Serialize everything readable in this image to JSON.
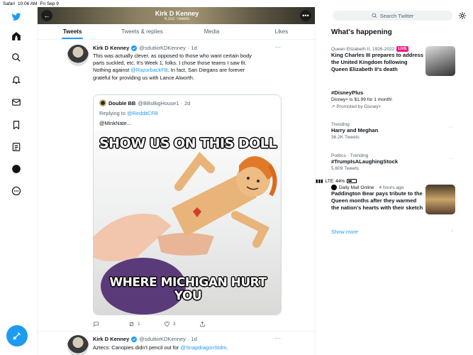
{
  "status_bar": {
    "back_app": "Safari",
    "time": "10:06 AM",
    "date": "Fri Sep 9",
    "network": "LTE",
    "battery": "44%"
  },
  "profile": {
    "name": "Kirk D Kenney",
    "tweet_count": "9,152 Tweets"
  },
  "tabs": [
    {
      "label": "Tweets",
      "active": true
    },
    {
      "label": "Tweets & replies",
      "active": false
    },
    {
      "label": "Media",
      "active": false
    },
    {
      "label": "Likes",
      "active": false
    }
  ],
  "tweet1": {
    "name": "Kirk D Kenney",
    "handle": "@sdutkirKDKenney",
    "time": "· 1d",
    "lines": [
      "This was actually clever, as opposed to those who want certain body",
      "parts suckled, etc. It's Week 1, folks. I chose those teams I saw fit.",
      "Nothing against ",
      "@RazorbackFB",
      ". In fact, San Diegans are forever",
      "grateful for providing us with Lance Alworth."
    ],
    "quote": {
      "name": "Double BB",
      "handle": "@BBsBigHouse1",
      "time": "· 2d",
      "replying_prefix": "Replying to ",
      "replying_to": "@RedditCFB",
      "text": "@MinkNate...",
      "meme_top": "SHOW US ON THIS DOLL",
      "meme_bottom_1": "WHERE MICHIGAN HURT",
      "meme_bottom_2": "YOU"
    },
    "retweets": "1",
    "likes": "3"
  },
  "tweet2": {
    "name": "Kirk D Kenney",
    "handle": "@sdutkirKDKenney",
    "time": "· 1d",
    "text_prefix": "Aztecs: Canopies didn't pencil out for ",
    "text_link": "@SnapdragonStdm",
    "text_suffix": "."
  },
  "search": {
    "placeholder": "Search Twitter"
  },
  "whats_happening": {
    "title": "What's happening",
    "trends": [
      {
        "meta": "Queen Elizabeth II, 1926-2022",
        "badge": "LIVE",
        "title": "King Charles III prepares to address the United Kingdom following Queen Elizabeth II's death"
      },
      {
        "title": "#DisneyPlus",
        "sub": "Disney+ is $1.99 for 1 month!",
        "promo": "Promoted by Disney+"
      },
      {
        "meta": "Trending",
        "title": "Harry and Meghan",
        "sub": "36.2K Tweets"
      },
      {
        "meta": "Politics · Trending",
        "title": "#TrumpIsALaughingStock",
        "sub": "5,609 Tweets"
      },
      {
        "source": "Daily Mail Online",
        "time": "· 4 hours ago",
        "title": "Paddington Bear pays tribute to the Queen months after they warmed the nation's hearts with their sketch"
      }
    ],
    "show_more": "Show more"
  },
  "colors": {
    "accent": "#1d9bf0",
    "live": "#f91880",
    "text": "#0f1419",
    "muted": "#536471"
  }
}
